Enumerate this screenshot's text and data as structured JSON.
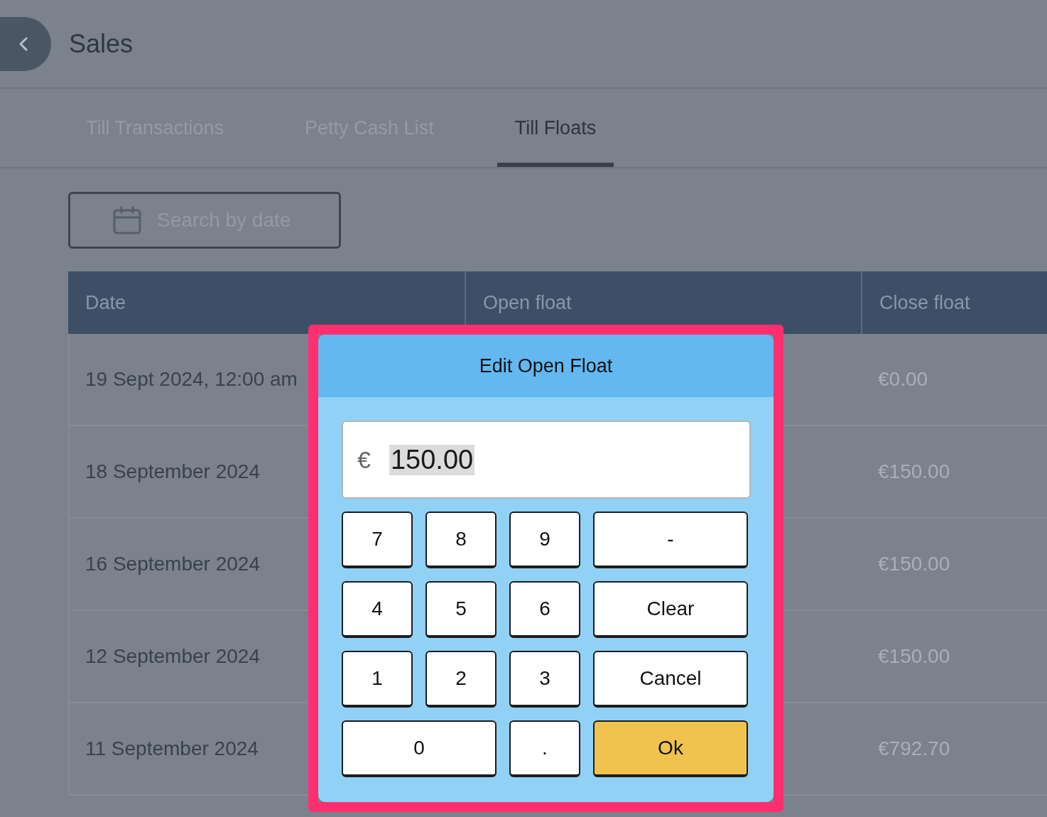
{
  "header": {
    "title": "Sales"
  },
  "tabs": [
    {
      "label": "Till Transactions",
      "selected": false
    },
    {
      "label": "Petty Cash List",
      "selected": false
    },
    {
      "label": "Till Floats",
      "selected": true
    }
  ],
  "search": {
    "placeholder": "Search by date"
  },
  "table": {
    "columns": [
      "Date",
      "Open float",
      "Close float"
    ],
    "rows": [
      {
        "date": "19 Sept 2024, 12:00 am",
        "close_float": "€0.00"
      },
      {
        "date": "18 September 2024",
        "close_float": "€150.00"
      },
      {
        "date": "16 September 2024",
        "close_float": "€150.00"
      },
      {
        "date": "12 September 2024",
        "close_float": "€150.00"
      },
      {
        "date": "11 September 2024",
        "close_float": "€792.70"
      }
    ]
  },
  "dialog": {
    "title": "Edit Open Float",
    "currency": "€",
    "value": "150.00",
    "value_selected": true,
    "keys": [
      {
        "label": "7",
        "kind": "key"
      },
      {
        "label": "8",
        "kind": "key"
      },
      {
        "label": "9",
        "kind": "key"
      },
      {
        "label": "-",
        "kind": "wide"
      },
      {
        "label": "4",
        "kind": "key"
      },
      {
        "label": "5",
        "kind": "key"
      },
      {
        "label": "6",
        "kind": "key"
      },
      {
        "label": "Clear",
        "kind": "wide"
      },
      {
        "label": "1",
        "kind": "key"
      },
      {
        "label": "2",
        "kind": "key"
      },
      {
        "label": "3",
        "kind": "key"
      },
      {
        "label": "Cancel",
        "kind": "wide"
      },
      {
        "label": "0",
        "kind": "wide"
      },
      {
        "label": ".",
        "kind": "key"
      },
      {
        "label": "Ok",
        "kind": "primary"
      }
    ]
  }
}
